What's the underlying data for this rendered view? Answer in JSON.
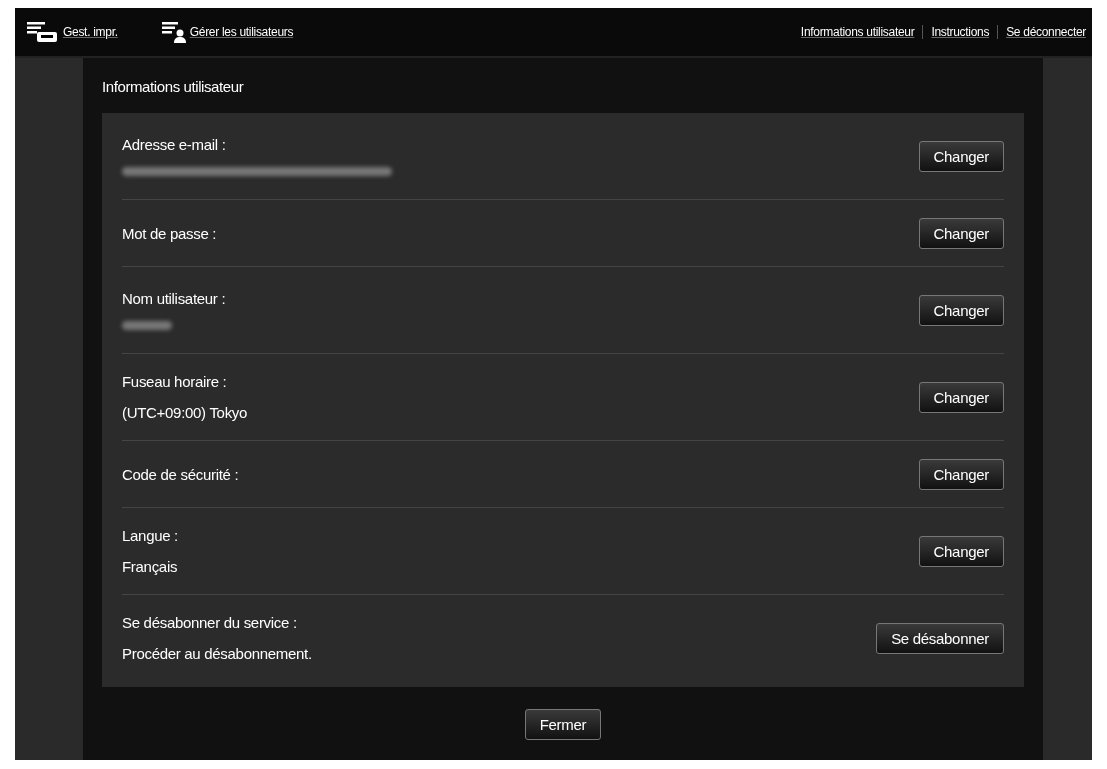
{
  "top_bar": {
    "left_links": [
      {
        "kind": "printer",
        "label": "Gest. impr."
      },
      {
        "kind": "users",
        "label": "Gérer les utilisateurs"
      }
    ],
    "right_links": [
      "Informations utilisateur",
      "Instructions",
      "Se déconnecter"
    ]
  },
  "dialog": {
    "title": "Informations utilisateur",
    "rows": [
      {
        "kind": "redacted",
        "label": "Adresse e-mail :",
        "button": "Changer"
      },
      {
        "kind": "plain",
        "label": "Mot de passe :",
        "button": "Changer"
      },
      {
        "kind": "redacted",
        "label": "Nom utilisateur :",
        "button": "Changer"
      },
      {
        "kind": "text",
        "label": "Fuseau horaire :",
        "value": "(UTC+09:00) Tokyo",
        "button": "Changer"
      },
      {
        "kind": "plain",
        "label": "Code de sécurité :",
        "button": "Changer"
      },
      {
        "kind": "text",
        "label": "Langue :",
        "value": "Français",
        "button": "Changer"
      },
      {
        "kind": "text",
        "label": "Se désabonner du service :",
        "value": "Procéder au désabonnement.",
        "button": "Se désabonner"
      }
    ],
    "close_button": "Fermer"
  }
}
